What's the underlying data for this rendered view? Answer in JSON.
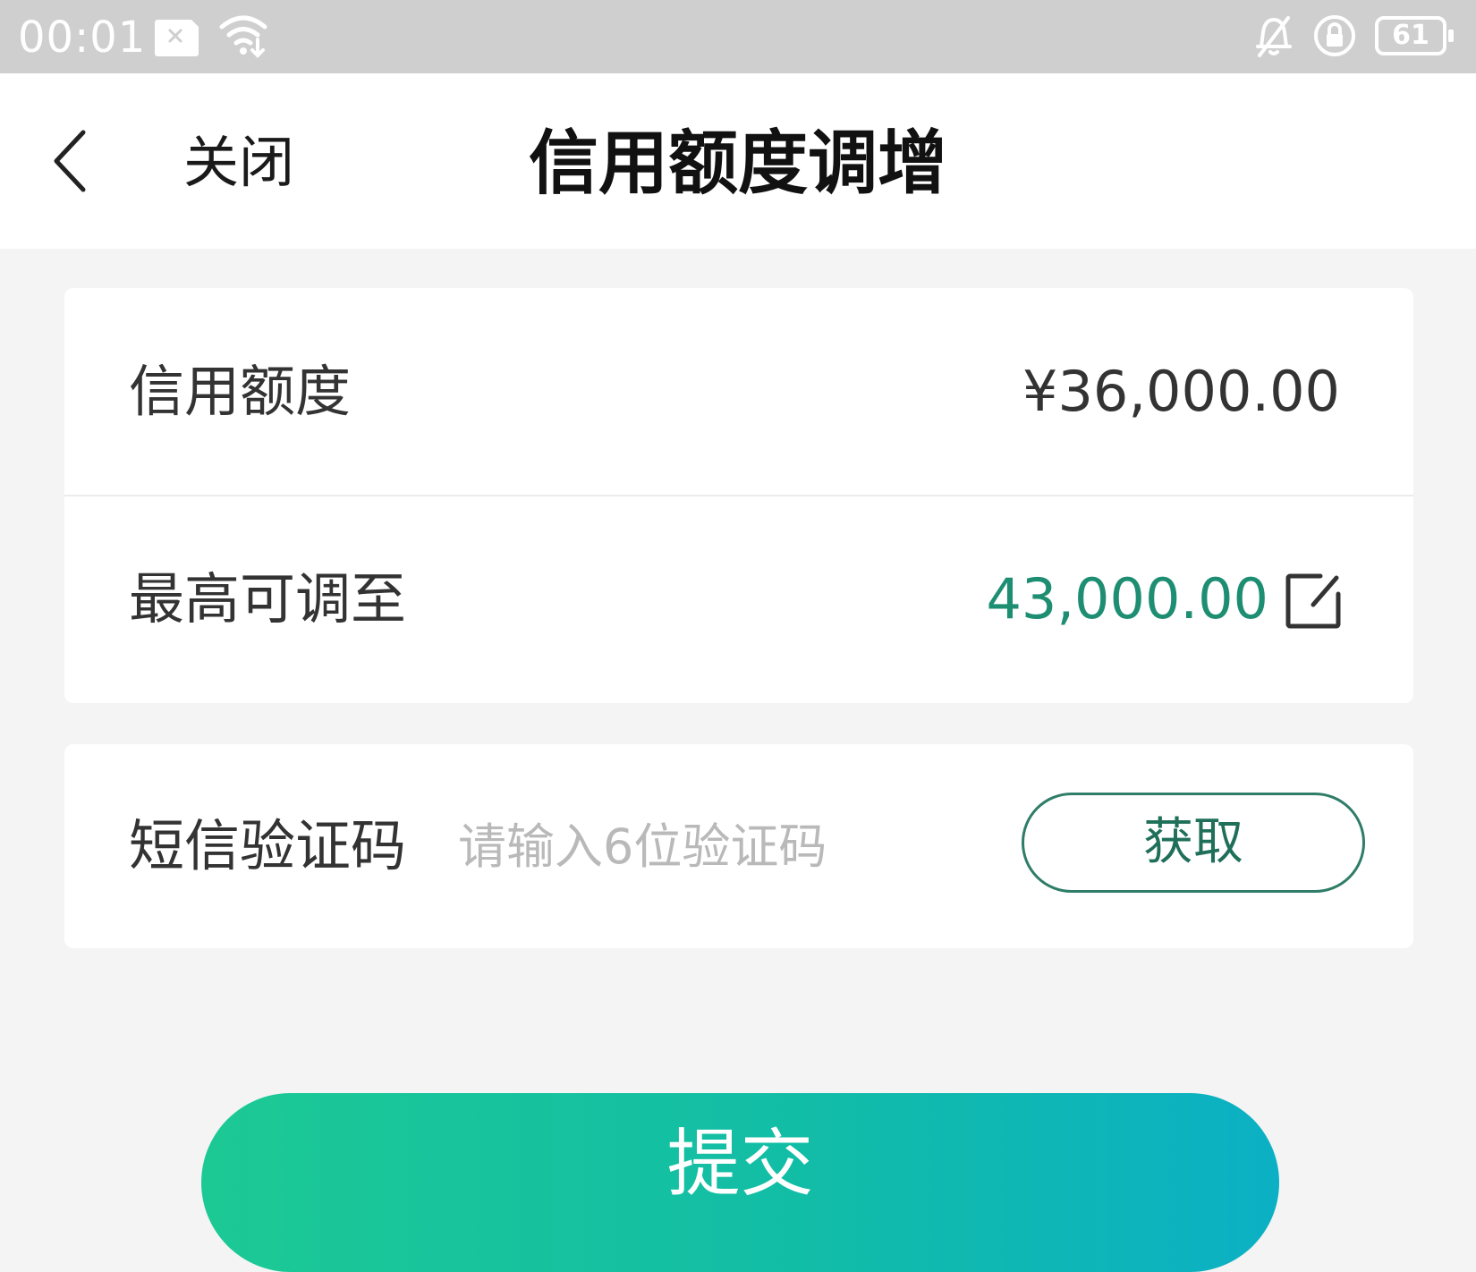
{
  "status_bar": {
    "time": "00:01",
    "battery_level": "61",
    "icons": [
      "sim-card-icon",
      "wifi-icon",
      "mute-bell-icon",
      "rotation-lock-icon",
      "battery-icon"
    ]
  },
  "nav": {
    "back_icon": "chevron-left-icon",
    "close_label": "关闭",
    "title": "信用额度调增"
  },
  "limit_card": {
    "current_label": "信用额度",
    "current_value": "¥36,000.00",
    "max_label": "最高可调至",
    "max_value": "43,000.00",
    "edit_icon": "edit-icon"
  },
  "sms_card": {
    "label": "短信验证码",
    "placeholder": "请输入6位验证码",
    "value": "",
    "get_code_label": "获取"
  },
  "submit": {
    "label": "提交"
  },
  "colors": {
    "accent_green": "#1e8e72",
    "button_gradient_start": "#1cc994",
    "button_gradient_end": "#0bb0c4",
    "status_bar_bg": "#cfcfcf",
    "page_bg": "#f4f4f4"
  }
}
